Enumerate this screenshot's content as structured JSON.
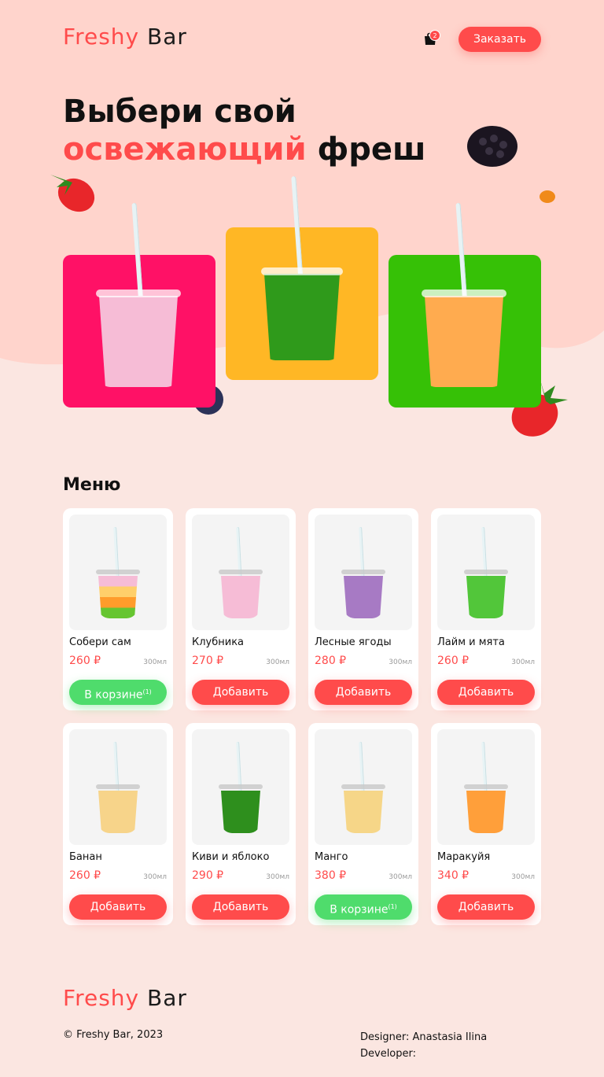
{
  "header": {
    "logo_part1": "Freshy",
    "logo_part2": "Bar",
    "cart_count": "2",
    "order_button": "Заказать"
  },
  "hero": {
    "title_line1": "Выбери свой",
    "title_accent": "освежающий",
    "title_end": "фреш",
    "cards": [
      {
        "color": "#ff1166",
        "drink_color": "#f6bcd6"
      },
      {
        "color": "#ffb725",
        "drink_color": "#2f9a1b"
      },
      {
        "color": "#36c106",
        "drink_color": "#ffab4f"
      }
    ]
  },
  "menu": {
    "title": "Меню",
    "items": [
      {
        "name": "Собери сам",
        "price": "260 ₽",
        "volume": "300мл",
        "button": "В корзине",
        "count": "(1)",
        "in_cart": true,
        "drink": [
          "#f6bcd6",
          "#ffcf6a",
          "#ff9c2b",
          "#66c531"
        ]
      },
      {
        "name": "Клубника",
        "price": "270 ₽",
        "volume": "300мл",
        "button": "Добавить",
        "count": "",
        "in_cart": false,
        "drink": [
          "#f6bcd6"
        ]
      },
      {
        "name": "Лесные ягоды",
        "price": "280 ₽",
        "volume": "300мл",
        "button": "Добавить",
        "count": "",
        "in_cart": false,
        "drink": [
          "#a77ac4"
        ]
      },
      {
        "name": "Лайм и мята",
        "price": "260 ₽",
        "volume": "300мл",
        "button": "Добавить",
        "count": "",
        "in_cart": false,
        "drink": [
          "#52c63a"
        ]
      },
      {
        "name": "Банан",
        "price": "260 ₽",
        "volume": "300мл",
        "button": "Добавить",
        "count": "",
        "in_cart": false,
        "drink": [
          "#f7d48a"
        ]
      },
      {
        "name": "Киви и яблоко",
        "price": "290 ₽",
        "volume": "300мл",
        "button": "Добавить",
        "count": "",
        "in_cart": false,
        "drink": [
          "#2e8f1d"
        ]
      },
      {
        "name": "Манго",
        "price": "380 ₽",
        "volume": "300мл",
        "button": "В корзине",
        "count": "(1)",
        "in_cart": true,
        "drink": [
          "#f6d688"
        ]
      },
      {
        "name": "Маракуйя",
        "price": "340 ₽",
        "volume": "300мл",
        "button": "Добавить",
        "count": "",
        "in_cart": false,
        "drink": [
          "#ff9f3a"
        ]
      }
    ]
  },
  "footer": {
    "logo_part1": "Freshy",
    "logo_part2": "Bar",
    "copyright": "© Freshy Bar, 2023",
    "designer": "Designer: Anastasia Ilina",
    "developer": "Developer:"
  },
  "colors": {
    "accent": "#ff4b4b",
    "green_button": "#4fdc6c",
    "hero_bg": "#ffd4cc",
    "page_bg": "#fbe6e1"
  }
}
